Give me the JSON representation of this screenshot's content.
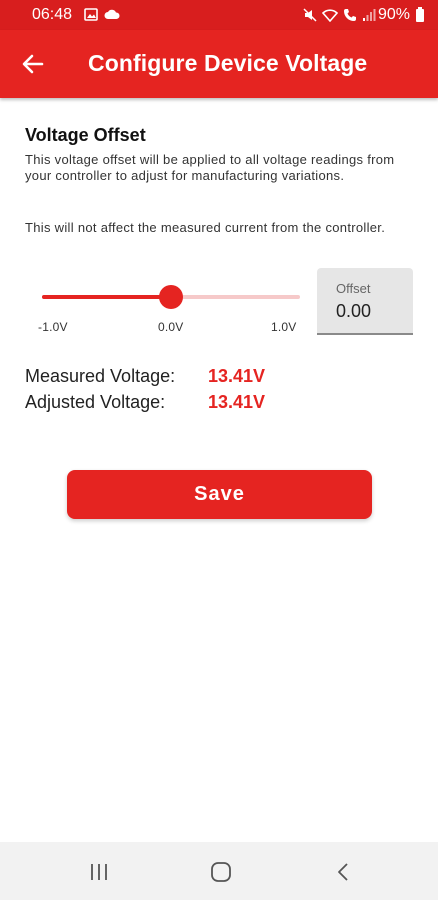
{
  "status_bar": {
    "time": "06:48",
    "battery": "90%",
    "icons_left": [
      "image-icon",
      "cloud-icon"
    ],
    "icons_right": [
      "mute-icon",
      "wifi-icon",
      "wifi-call-icon",
      "signal-icon"
    ]
  },
  "app_bar": {
    "title": "Configure Device Voltage",
    "back_icon": "back-arrow-icon",
    "color": "#e52421"
  },
  "voltage_offset": {
    "title": "Voltage Offset",
    "description": "This voltage offset will be applied to all voltage readings from your controller to adjust for manufacturing variations.",
    "note": "This will not affect the measured current from the controller.",
    "slider": {
      "min_label": "-1.0V",
      "mid_label": "0.0V",
      "max_label": "1.0V",
      "min": -1.0,
      "max": 1.0,
      "value": 0.0
    },
    "offset_field": {
      "label": "Offset",
      "value": "0.00"
    }
  },
  "readings": {
    "measured_label": "Measured Voltage:",
    "measured_value": "13.41V",
    "adjusted_label": "Adjusted Voltage:",
    "adjusted_value": "13.41V"
  },
  "actions": {
    "save_label": "Save"
  },
  "nav_bar": {
    "items": [
      "recents-icon",
      "home-icon",
      "back-icon"
    ]
  }
}
